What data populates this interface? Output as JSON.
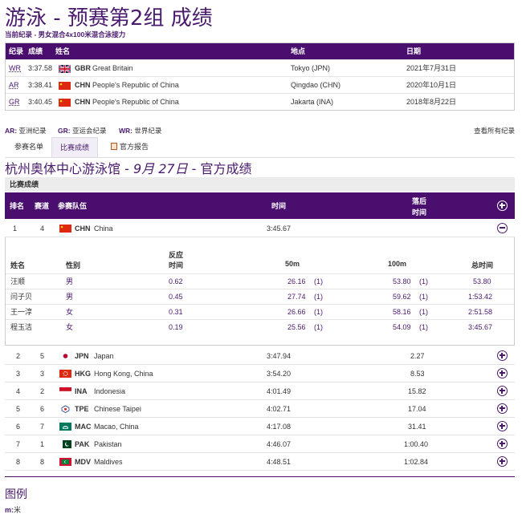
{
  "header": {
    "title": "游泳 - 预赛第2组 成绩",
    "subtitle": "当前纪录 - 男女混合4x100米混合泳接力"
  },
  "records": {
    "columns": [
      "纪录",
      "成绩",
      "姓名",
      "地点",
      "日期"
    ],
    "rows": [
      {
        "code": "WR",
        "time": "3:37.58",
        "noc": "GBR",
        "name": "Great Britain",
        "place": "Tokyo (JPN)",
        "date": "2021年7月31日",
        "flag": "gbr"
      },
      {
        "code": "AR",
        "time": "3:38.41",
        "noc": "CHN",
        "name": "People's Republic of China",
        "place": "Qingdao (CHN)",
        "date": "2020年10月1日",
        "flag": "chn"
      },
      {
        "code": "GR",
        "time": "3:40.45",
        "noc": "CHN",
        "name": "People's Republic of China",
        "place": "Jakarta (INA)",
        "date": "2018年8月22日",
        "flag": "chn"
      }
    ]
  },
  "abbr": {
    "ar_code": "AR:",
    "ar_text": "亚洲纪录",
    "gr_code": "GR:",
    "gr_text": "亚运会纪录",
    "wr_code": "WR:",
    "wr_text": "世界纪录",
    "all_records": "查看所有纪录"
  },
  "tabs": {
    "entry_list": "参赛名单",
    "results": "比赛成绩",
    "official_report": "官方报告"
  },
  "venue": {
    "name": "杭州奥体中心游泳馆 - ",
    "date": "9月 27日",
    "suffix": " - 官方成绩"
  },
  "section_label": "比赛成绩",
  "results_header": {
    "rank": "排名",
    "lane": "赛道",
    "team": "参赛队伍",
    "time": "时间",
    "behind_1": "落后",
    "behind_2": "时间"
  },
  "results": [
    {
      "rank": "1",
      "lane": "4",
      "noc": "CHN",
      "name": "China",
      "time": "3:45.67",
      "behind": "",
      "flag": "chn",
      "expanded": true
    },
    {
      "rank": "2",
      "lane": "5",
      "noc": "JPN",
      "name": "Japan",
      "time": "3:47.94",
      "behind": "2.27",
      "flag": "jpn",
      "expanded": false
    },
    {
      "rank": "3",
      "lane": "3",
      "noc": "HKG",
      "name": "Hong Kong, China",
      "time": "3:54.20",
      "behind": "8.53",
      "flag": "hkg",
      "expanded": false
    },
    {
      "rank": "4",
      "lane": "2",
      "noc": "INA",
      "name": "Indonesia",
      "time": "4:01.49",
      "behind": "15.82",
      "flag": "ina",
      "expanded": false
    },
    {
      "rank": "5",
      "lane": "6",
      "noc": "TPE",
      "name": "Chinese Taipei",
      "time": "4:02.71",
      "behind": "17.04",
      "flag": "tpe",
      "expanded": false
    },
    {
      "rank": "6",
      "lane": "7",
      "noc": "MAC",
      "name": "Macao, China",
      "time": "4:17.08",
      "behind": "31.41",
      "flag": "mac",
      "expanded": false
    },
    {
      "rank": "7",
      "lane": "1",
      "noc": "PAK",
      "name": "Pakistan",
      "time": "4:46.07",
      "behind": "1:00.40",
      "flag": "pak",
      "expanded": false
    },
    {
      "rank": "8",
      "lane": "8",
      "noc": "MDV",
      "name": "Maldives",
      "time": "4:48.51",
      "behind": "1:02.84",
      "flag": "mdv",
      "expanded": false
    }
  ],
  "detail": {
    "columns": {
      "name": "姓名",
      "gender": "性别",
      "reaction_1": "反应",
      "reaction_2": "时间",
      "m50": "50m",
      "m100": "100m",
      "total": "总时间"
    },
    "swimmers": [
      {
        "name": "汪顺",
        "gender": "男",
        "reaction": "0.62",
        "t50": "26.16",
        "r50": "(1)",
        "t100": "53.80",
        "r100": "(1)",
        "total": "53.80"
      },
      {
        "name": "闫子贝",
        "gender": "男",
        "reaction": "0.45",
        "t50": "27.74",
        "r50": "(1)",
        "t100": "59.62",
        "r100": "(1)",
        "total": "1:53.42"
      },
      {
        "name": "王一淳",
        "gender": "女",
        "reaction": "0.31",
        "t50": "26.66",
        "r50": "(1)",
        "t100": "58.16",
        "r100": "(1)",
        "total": "2:51.58"
      },
      {
        "name": "程玉洁",
        "gender": "女",
        "reaction": "0.19",
        "t50": "25.56",
        "r50": "(1)",
        "t100": "54.09",
        "r100": "(1)",
        "total": "3:45.67"
      }
    ]
  },
  "legend": {
    "title": "图例",
    "m_code": "m:",
    "m_text": "米"
  },
  "colors": {
    "primary": "#4a0e6e",
    "accent_text": "#4a1a6e"
  }
}
